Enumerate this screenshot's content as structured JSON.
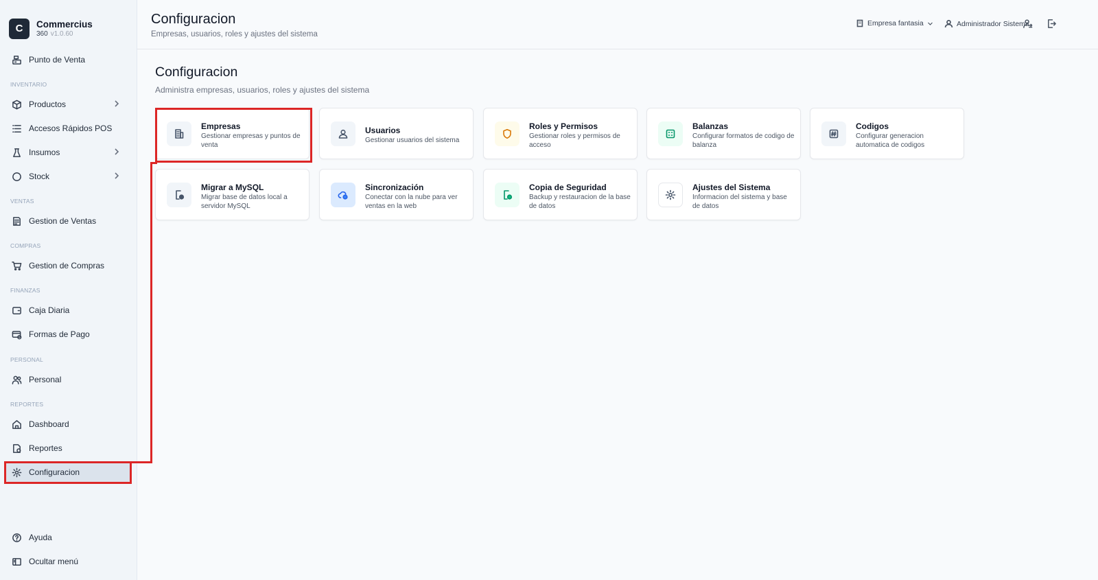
{
  "brand": {
    "logo_letter": "C",
    "name": "Commercius",
    "sub": "360",
    "version": "v1.0.60"
  },
  "sidebar": {
    "sections": {
      "inventario": "INVENTARIO",
      "ventas": "VENTAS",
      "compras": "COMPRAS",
      "finanzas": "FINANZAS",
      "personal": "PERSONAL",
      "reportes": "REPORTES"
    },
    "items": {
      "pos": "Punto de Venta",
      "productos": "Productos",
      "accesos": "Accesos Rápidos POS",
      "insumos": "Insumos",
      "stock": "Stock",
      "gestion_ventas": "Gestion de Ventas",
      "gestion_compras": "Gestion de Compras",
      "caja": "Caja Diaria",
      "formas_pago": "Formas de Pago",
      "personal": "Personal",
      "dashboard": "Dashboard",
      "reportes": "Reportes",
      "configuracion": "Configuracion",
      "ayuda": "Ayuda",
      "ocultar": "Ocultar menú"
    }
  },
  "header": {
    "title": "Configuracion",
    "subtitle": "Empresas, usuarios, roles y ajustes del sistema",
    "company": "Empresa fantasia",
    "user": "Administrador Sistema"
  },
  "main": {
    "title": "Configuracion",
    "subtitle": "Administra empresas, usuarios, roles y ajustes del sistema",
    "cards": {
      "empresas": {
        "title": "Empresas",
        "desc": "Gestionar empresas y puntos de venta"
      },
      "usuarios": {
        "title": "Usuarios",
        "desc": "Gestionar usuarios del sistema"
      },
      "roles": {
        "title": "Roles y Permisos",
        "desc": "Gestionar roles y permisos de acceso"
      },
      "balanzas": {
        "title": "Balanzas",
        "desc": "Configurar formatos de codigo de balanza"
      },
      "codigos": {
        "title": "Codigos",
        "desc": "Configurar generacion automatica de codigos"
      },
      "mysql": {
        "title": "Migrar a MySQL",
        "desc": "Migrar base de datos local a servidor MySQL"
      },
      "sync": {
        "title": "Sincronización",
        "desc": "Conectar con la nube para ver ventas en la web"
      },
      "backup": {
        "title": "Copia de Seguridad",
        "desc": "Backup y restauracion de la base de datos"
      },
      "ajustes": {
        "title": "Ajustes del Sistema",
        "desc": "Informacion del sistema y base de datos"
      }
    }
  },
  "colors": {
    "highlight": "#dc2626",
    "active_nav": "#dbe3ec",
    "logo_bg": "#1f2937"
  }
}
